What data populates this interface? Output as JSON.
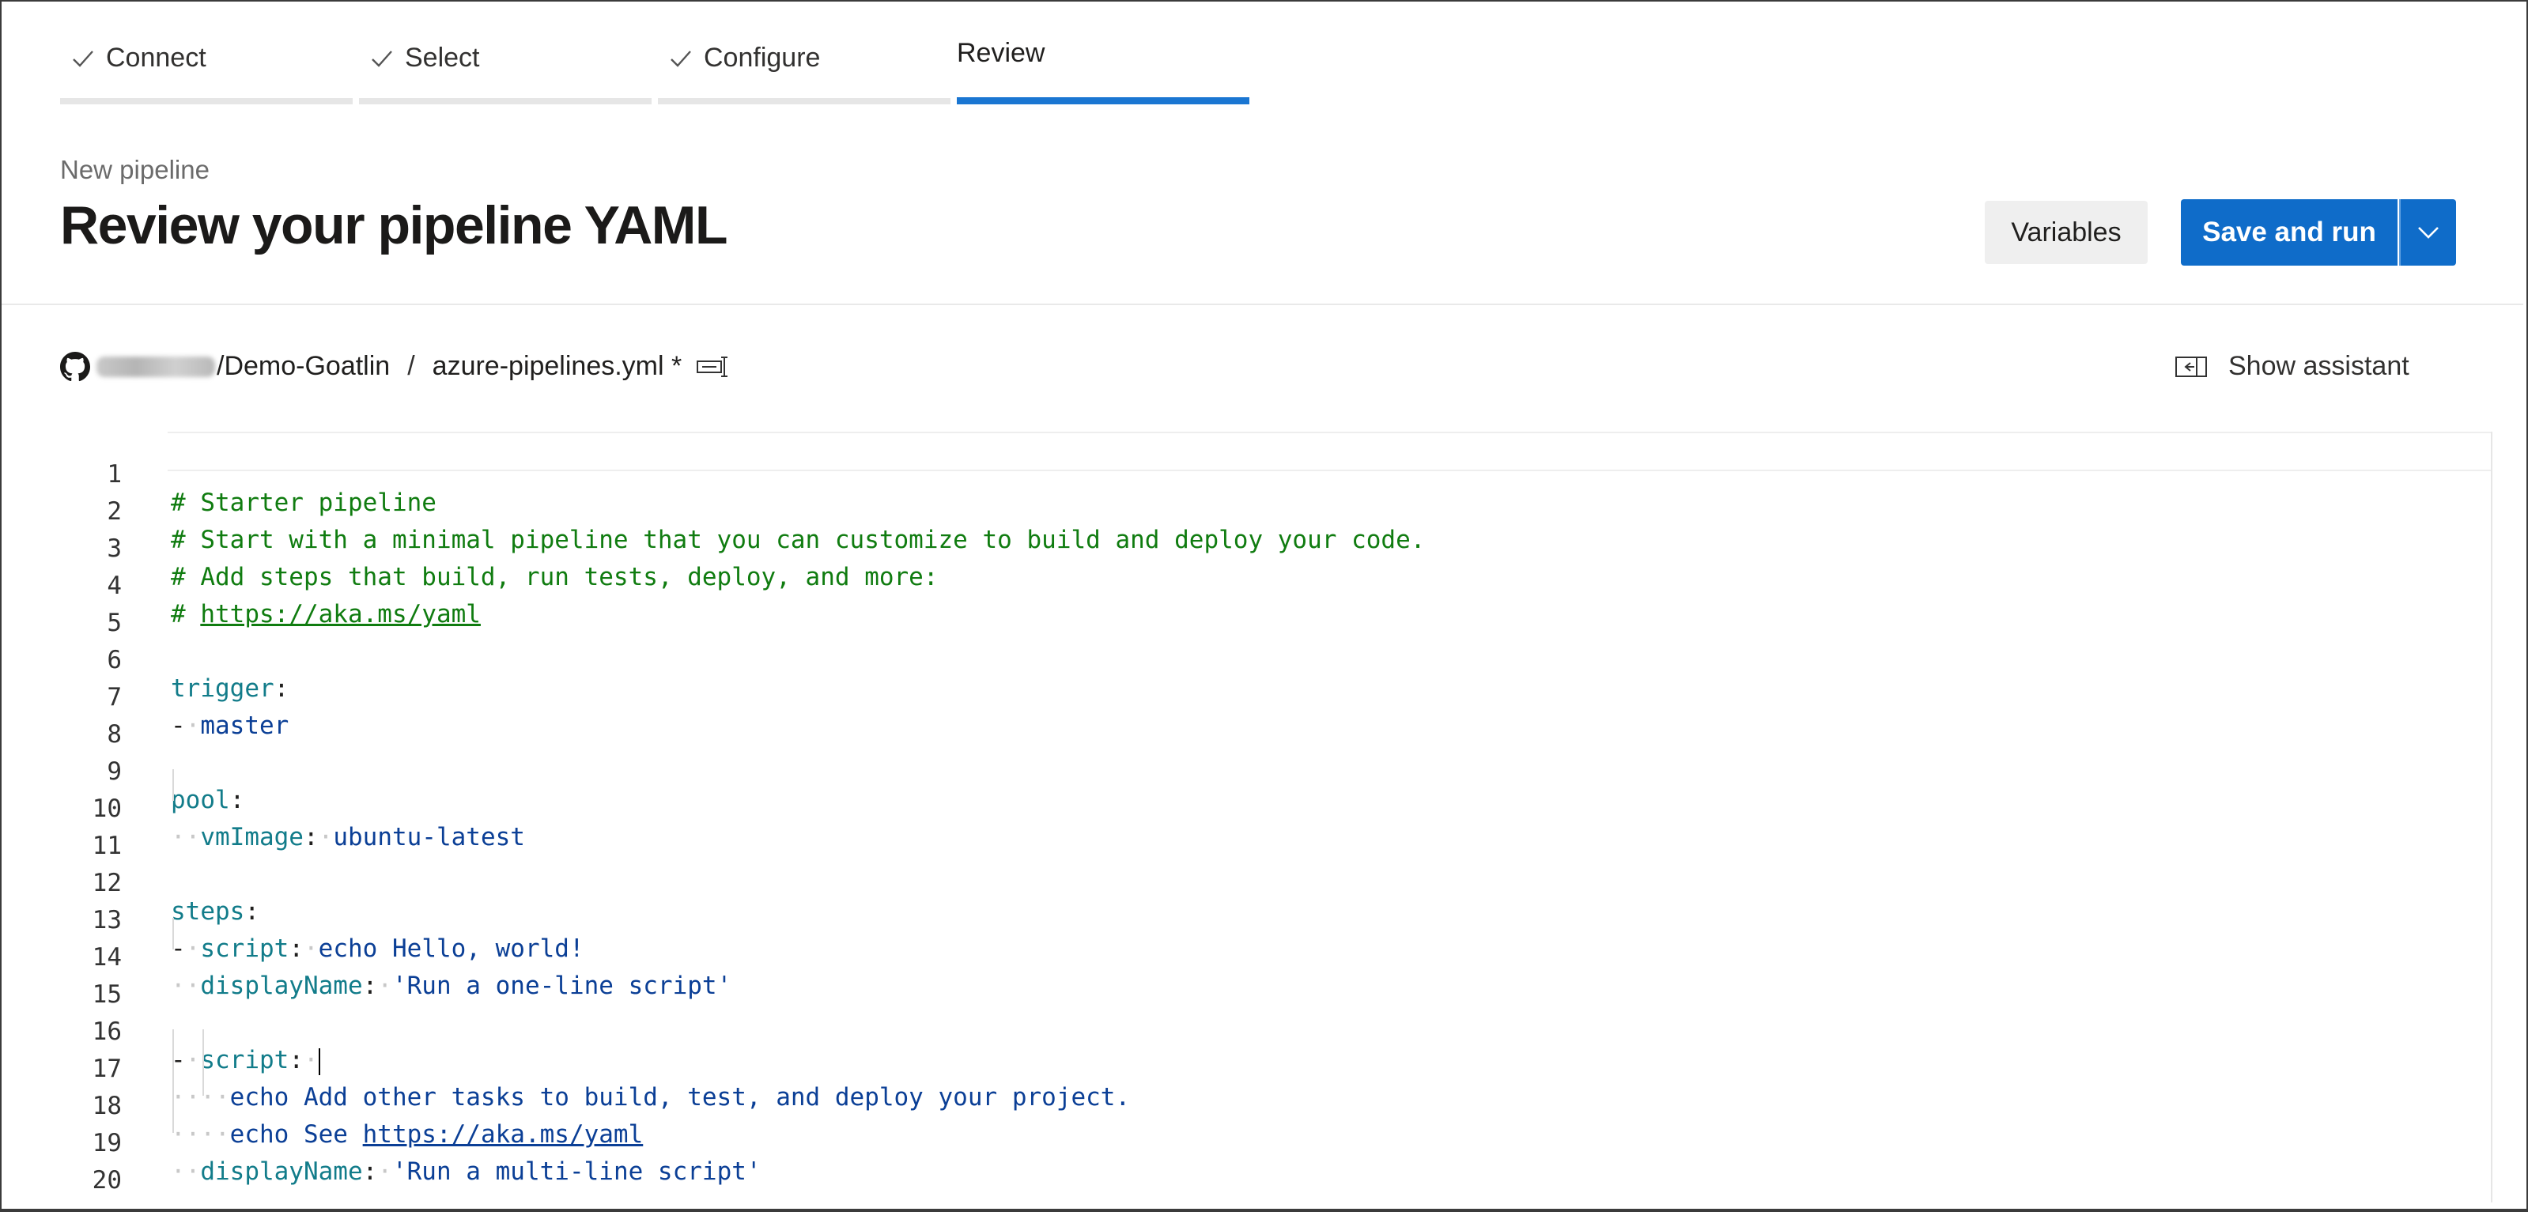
{
  "wizard": {
    "steps": [
      {
        "label": "Connect",
        "done": true
      },
      {
        "label": "Select",
        "done": true
      },
      {
        "label": "Configure",
        "done": true
      },
      {
        "label": "Review",
        "done": false,
        "active": true
      }
    ]
  },
  "header": {
    "subtitle": "New pipeline",
    "title": "Review your pipeline YAML",
    "variables_label": "Variables",
    "save_run_label": "Save and run"
  },
  "path": {
    "repo": "/Demo-Goatlin",
    "separator": "/",
    "file": "azure-pipelines.yml *"
  },
  "assistant": {
    "label": "Show assistant"
  },
  "editor": {
    "line_numbers": [
      "1",
      "2",
      "3",
      "4",
      "5",
      "6",
      "7",
      "8",
      "9",
      "10",
      "11",
      "12",
      "13",
      "14",
      "15",
      "16",
      "17",
      "18",
      "19",
      "20"
    ],
    "l1": "# Starter pipeline",
    "l2": "# Start with a minimal pipeline that you can customize to build and deploy your code.",
    "l3": "# Add steps that build, run tests, deploy, and more:",
    "l4_hash": "# ",
    "l4_link": "https://aka.ms/yaml",
    "l6_key": "trigger",
    "l7_val": "master",
    "l9_key": "pool",
    "l10_key": "vmImage",
    "l10_val": "ubuntu-latest",
    "l12_key": "steps",
    "l13_key": "script",
    "l13_val": "echo Hello, world!",
    "l14_key": "displayName",
    "l14_val": "'Run a one-line script'",
    "l16_key": "script",
    "l17_val": "echo Add other tasks to build, test, and deploy your project.",
    "l18_val": "echo See ",
    "l18_link": "https://aka.ms/yaml",
    "l19_key": "displayName",
    "l19_val": "'Run a multi-line script'"
  },
  "colors": {
    "accent": "#0f6cc9",
    "comment": "#107c10",
    "key": "#127c8a",
    "value": "#0b3f96"
  },
  "icons": [
    "check-icon",
    "github-icon",
    "keyboard-shortcut-icon",
    "assistant-panel-icon",
    "chevron-down-icon"
  ]
}
